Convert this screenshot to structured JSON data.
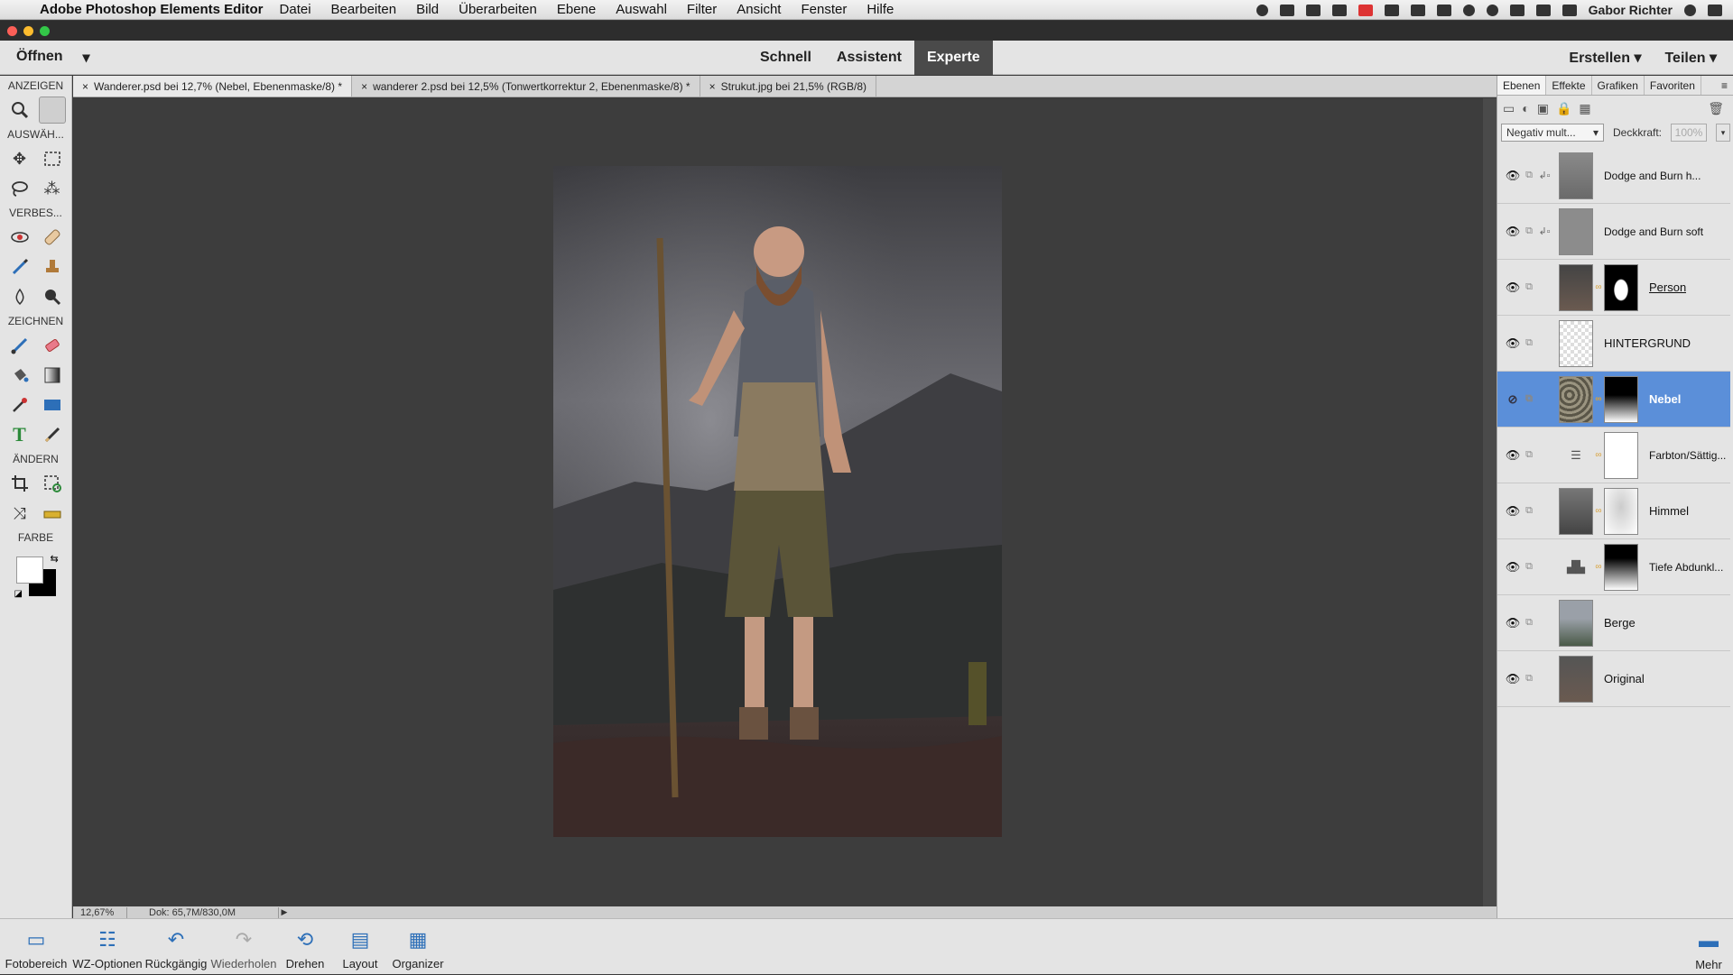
{
  "menubar": {
    "app_name": "Adobe Photoshop Elements Editor",
    "items": [
      "Datei",
      "Bearbeiten",
      "Bild",
      "Überarbeiten",
      "Ebene",
      "Auswahl",
      "Filter",
      "Ansicht",
      "Fenster",
      "Hilfe"
    ],
    "user": "Gabor Richter"
  },
  "topbar": {
    "open_label": "Öffnen",
    "modes": [
      "Schnell",
      "Assistent",
      "Experte"
    ],
    "active_mode": "Experte",
    "create_label": "Erstellen",
    "share_label": "Teilen"
  },
  "toolbox": {
    "sections": [
      "ANZEIGEN",
      "AUSWÄH...",
      "VERBES...",
      "ZEICHNEN",
      "ÄNDERN",
      "FARBE"
    ]
  },
  "doc_tabs": [
    "Wanderer.psd bei 12,7% (Nebel, Ebenenmaske/8) *",
    "wanderer 2.psd bei 12,5% (Tonwertkorrektur 2, Ebenenmaske/8) *",
    "Strukut.jpg bei 21,5% (RGB/8)"
  ],
  "status": {
    "zoom": "12,67%",
    "doc": "Dok: 65,7M/830,0M"
  },
  "panel": {
    "tabs": [
      "Ebenen",
      "Effekte",
      "Grafiken",
      "Favoriten"
    ],
    "blend_mode": "Negativ mult...",
    "opacity_label": "Deckkraft:",
    "opacity_value": "100%",
    "layers": [
      {
        "name": "Dodge and Burn h..."
      },
      {
        "name": "Dodge and Burn soft"
      },
      {
        "name": "Person"
      },
      {
        "name": "HINTERGRUND"
      },
      {
        "name": "Nebel"
      },
      {
        "name": "Farbton/Sättig..."
      },
      {
        "name": "Himmel"
      },
      {
        "name": "Tiefe Abdunkl..."
      },
      {
        "name": "Berge"
      },
      {
        "name": "Original"
      }
    ]
  },
  "bottombar": {
    "items": [
      "Fotobereich",
      "WZ-Optionen",
      "Rückgängig",
      "Wiederholen",
      "Drehen",
      "Layout",
      "Organizer"
    ],
    "more": "Mehr"
  }
}
